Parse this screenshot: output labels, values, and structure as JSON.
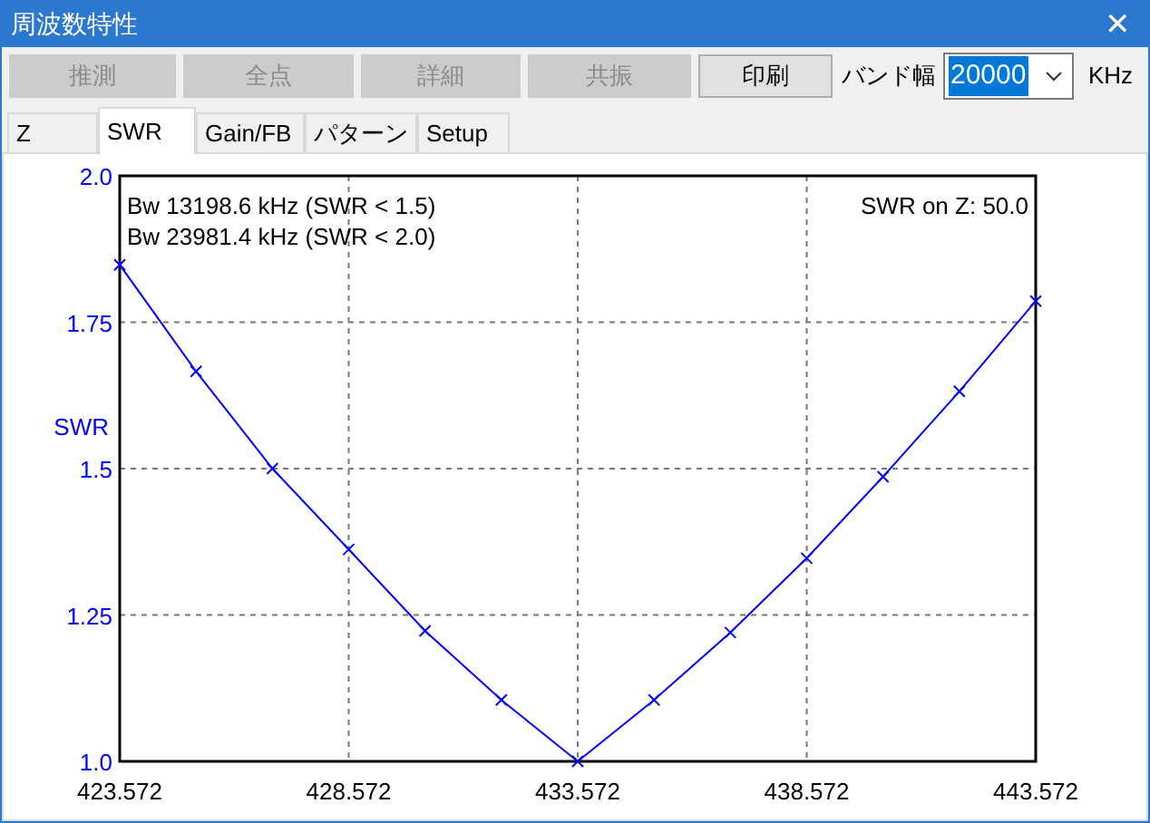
{
  "window": {
    "title": "周波数特性",
    "close": "✕"
  },
  "toolbar": {
    "buttons": [
      {
        "label": "推測",
        "disabled": true
      },
      {
        "label": "全点",
        "disabled": true
      },
      {
        "label": "詳細",
        "disabled": true
      },
      {
        "label": "共振",
        "disabled": true
      },
      {
        "label": "印刷",
        "disabled": false
      }
    ],
    "bandwidth": {
      "label": "バンド幅",
      "value": "20000",
      "unit": "KHz"
    }
  },
  "tabs": [
    {
      "label": "Z",
      "selected": false
    },
    {
      "label": "SWR",
      "selected": true
    },
    {
      "label": "Gain/FB",
      "selected": false
    },
    {
      "label": "パターン",
      "selected": false
    },
    {
      "label": "Setup",
      "selected": false
    }
  ],
  "panel": {
    "notes": [
      "Bw 13198.6 kHz (SWR < 1.5)",
      "Bw 23981.4 kHz (SWR < 2.0)"
    ],
    "reference": "SWR on Z: 50.0",
    "chart_data": {
      "type": "line",
      "ylabel": "SWR",
      "x": [
        423.572,
        425.239,
        426.905,
        428.572,
        430.239,
        431.905,
        433.572,
        435.239,
        436.905,
        438.572,
        440.239,
        441.905,
        443.572
      ],
      "grid": true,
      "series": [
        {
          "color": "#0000ff",
          "marker": "x",
          "values": [
            1.848,
            1.666,
            1.5,
            1.362,
            1.223,
            1.105,
            1.0,
            1.105,
            1.22,
            1.347,
            1.486,
            1.632,
            1.786
          ]
        }
      ],
      "xlim": [
        423.572,
        443.572
      ],
      "ylim": [
        1.0,
        2.0
      ],
      "xticks": [
        {
          "value": 423.572,
          "label": "423.572"
        },
        {
          "value": 428.572,
          "label": "428.572"
        },
        {
          "value": 433.572,
          "label": "433.572"
        },
        {
          "value": 438.572,
          "label": "438.572"
        },
        {
          "value": 443.572,
          "label": "443.572"
        }
      ],
      "yticks": [
        {
          "value": 1.0,
          "label": "1.0"
        },
        {
          "value": 1.25,
          "label": "1.25"
        },
        {
          "value": 1.5,
          "label": "1.5"
        },
        {
          "value": 1.75,
          "label": "1.75"
        },
        {
          "value": 2.0,
          "label": "2.0"
        }
      ]
    }
  }
}
